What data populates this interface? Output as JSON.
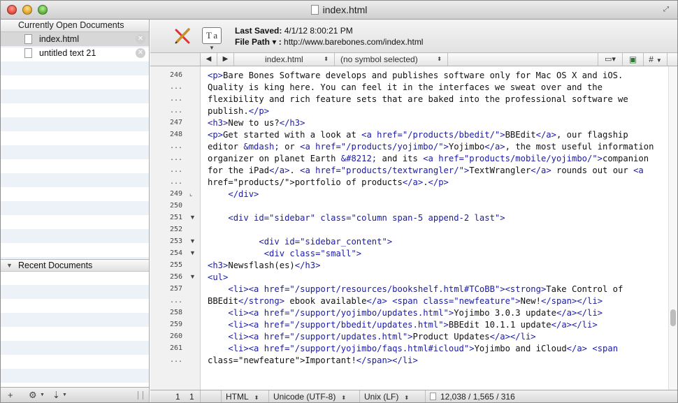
{
  "window": {
    "title": "index.html"
  },
  "sidebar": {
    "open_header": "Currently Open Documents",
    "open_docs": [
      {
        "name": "index.html",
        "selected": true
      },
      {
        "name": "untitled text 21",
        "selected": false
      }
    ],
    "recent_header": "Recent Documents",
    "bottom_buttons": [
      "+",
      "⚙",
      "⇣"
    ]
  },
  "toolbar": {
    "last_saved_label": "Last Saved:",
    "last_saved_value": "4/1/12 8:00:21 PM",
    "file_path_label": "File Path ▾ :",
    "file_path_value": "http://www.barebones.com/index.html",
    "text_options_glyph": "T a"
  },
  "navbar": {
    "back": "◀",
    "forward": "▶",
    "file_menu": "index.html",
    "symbol_menu": "(no symbol selected)",
    "right_menu": "#"
  },
  "gutter": [
    {
      "n": "246",
      "fold": ""
    },
    {
      "n": "...",
      "fold": ""
    },
    {
      "n": "...",
      "fold": ""
    },
    {
      "n": "...",
      "fold": ""
    },
    {
      "n": "247",
      "fold": ""
    },
    {
      "n": "248",
      "fold": ""
    },
    {
      "n": "...",
      "fold": ""
    },
    {
      "n": "...",
      "fold": ""
    },
    {
      "n": "...",
      "fold": ""
    },
    {
      "n": "...",
      "fold": ""
    },
    {
      "n": "249",
      "fold": "⌞"
    },
    {
      "n": "250",
      "fold": ""
    },
    {
      "n": "251",
      "fold": "▼"
    },
    {
      "n": "252",
      "fold": ""
    },
    {
      "n": "253",
      "fold": "▼"
    },
    {
      "n": "254",
      "fold": "▼"
    },
    {
      "n": "255",
      "fold": ""
    },
    {
      "n": "256",
      "fold": "▼"
    },
    {
      "n": "257",
      "fold": ""
    },
    {
      "n": "...",
      "fold": ""
    },
    {
      "n": "258",
      "fold": ""
    },
    {
      "n": "259",
      "fold": ""
    },
    {
      "n": "260",
      "fold": ""
    },
    {
      "n": "261",
      "fold": ""
    },
    {
      "n": "...",
      "fold": ""
    }
  ],
  "code": [
    "<p>Bare Bones Software develops and publishes software only for Mac OS X and iOS.",
    "Quality is king here. You can feel it in the interfaces we sweat over and the",
    "flexibility and rich feature sets that are baked into the professional software we",
    "publish.</p>",
    "<h3>New to us?</h3>",
    "<p>Get started with a look at <a href=\"/products/bbedit/\">BBEdit</a>, our flagship",
    "editor &mdash; or <a href=\"/products/yojimbo/\">Yojimbo</a>, the most useful information",
    "organizer on planet Earth &#8212; and its <a href=\"products/mobile/yojimbo/\">companion",
    "for the iPad</a>. <a href=\"products/textwrangler/\">TextWrangler</a> rounds out our <a",
    "href=\"products/\">portfolio of products</a>.</p>",
    "    </div>",
    "",
    "    <div id=\"sidebar\" class=\"column span-5 append-2 last\">",
    "",
    "          <div id=\"sidebar_content\">",
    "           <div class=\"small\">",
    "<h3>Newsflash(es)</h3>",
    "<ul>",
    "    <li><a href=\"/support/resources/bookshelf.html#TCoBB\"><strong>Take Control of",
    "BBEdit</strong> ebook available</a> <span class=\"newfeature\">New!</span></li>",
    "    <li><a href=\"/support/yojimbo/updates.html\">Yojimbo 3.0.3 update</a></li>",
    "    <li><a href=\"/support/bbedit/updates.html\">BBEdit 10.1.1 update</a></li>",
    "    <li><a href=\"/support/updates.html\">Product Updates</a></li>",
    "    <li><a href=\"/support/yojimbo/faqs.html#icloud\">Yojimbo and iCloud</a> <span",
    "class=\"newfeature\">Important!</span></li>"
  ],
  "statusbar": {
    "line": "1",
    "col": "1",
    "language": "HTML",
    "encoding": "Unicode (UTF-8)",
    "line_endings": "Unix (LF)",
    "counts": "12,038 / 1,565 / 316"
  },
  "colors": {
    "tag": "#1a1aa6",
    "selection": "#d7d7d7",
    "stripe": "#edf2f9"
  }
}
